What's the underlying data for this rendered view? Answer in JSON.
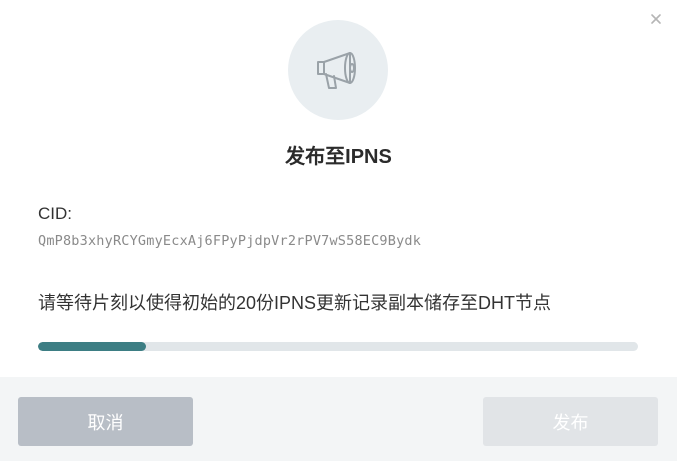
{
  "dialog": {
    "title": "发布至IPNS",
    "cid_label": "CID:",
    "cid_value": "QmP8b3xhyRCYGmyEcxAj6FPyPjdpVr2rPV7wS58EC9Bydk",
    "message": "请等待片刻以使得初始的20份IPNS更新记录副本储存至DHT节点",
    "progress": 0.18,
    "icons": {
      "close": "close-icon",
      "hero": "megaphone-icon"
    },
    "colors": {
      "progress_fill": "#3d7e84",
      "progress_track": "#e1e6e9",
      "cancel_button": "#b8bec6",
      "publish_button_disabled": "#e1e4e7"
    }
  },
  "footer": {
    "cancel_label": "取消",
    "publish_label": "发布"
  }
}
